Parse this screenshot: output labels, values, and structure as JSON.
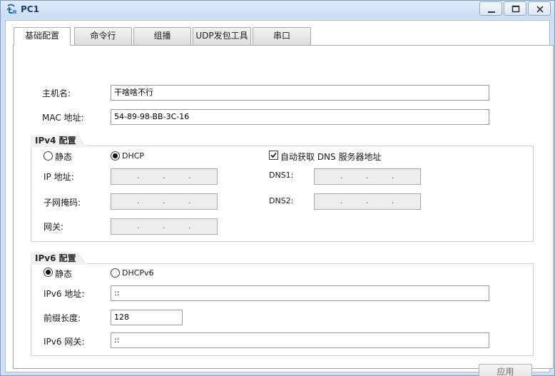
{
  "window": {
    "title": "PC1",
    "minimize": "—",
    "maximize": "□",
    "close": "X"
  },
  "tabs": [
    {
      "label": "基础配置",
      "active": true
    },
    {
      "label": "命令行",
      "active": false
    },
    {
      "label": "组播",
      "active": false
    },
    {
      "label": "UDP发包工具",
      "active": false
    },
    {
      "label": "串口",
      "active": false
    }
  ],
  "basic": {
    "hostname_label": "主机名:",
    "hostname_value": "干啥啥不行",
    "mac_label": "MAC 地址:",
    "mac_value": "54-89-98-BB-3C-16"
  },
  "ipv4": {
    "group_title": "IPv4 配置",
    "static_label": "静态",
    "dhcp_label": "DHCP",
    "mode": "DHCP",
    "auto_dns_label": "自动获取 DNS 服务器地址",
    "auto_dns_checked": true,
    "ip_label": "IP 地址:",
    "mask_label": "子网掩码:",
    "gateway_label": "网关:",
    "dns1_label": "DNS1:",
    "dns2_label": "DNS2:",
    "dot": "."
  },
  "ipv6": {
    "group_title": "IPv6 配置",
    "static_label": "静态",
    "dhcp_label": "DHCPv6",
    "mode": "静态",
    "addr_label": "IPv6 地址:",
    "addr_value": "::",
    "prefix_label": "前缀长度:",
    "prefix_value": "128",
    "gateway_label": "IPv6 网关:",
    "gateway_value": "::"
  },
  "apply_label": "应用",
  "colors": {
    "titlebar": "#c9dcf1",
    "disabled_field": "#ececec",
    "apply_text": "#6f6f6f"
  },
  "icons": [
    "app-network-icon",
    "minimize-icon",
    "maximize-icon",
    "close-icon"
  ]
}
